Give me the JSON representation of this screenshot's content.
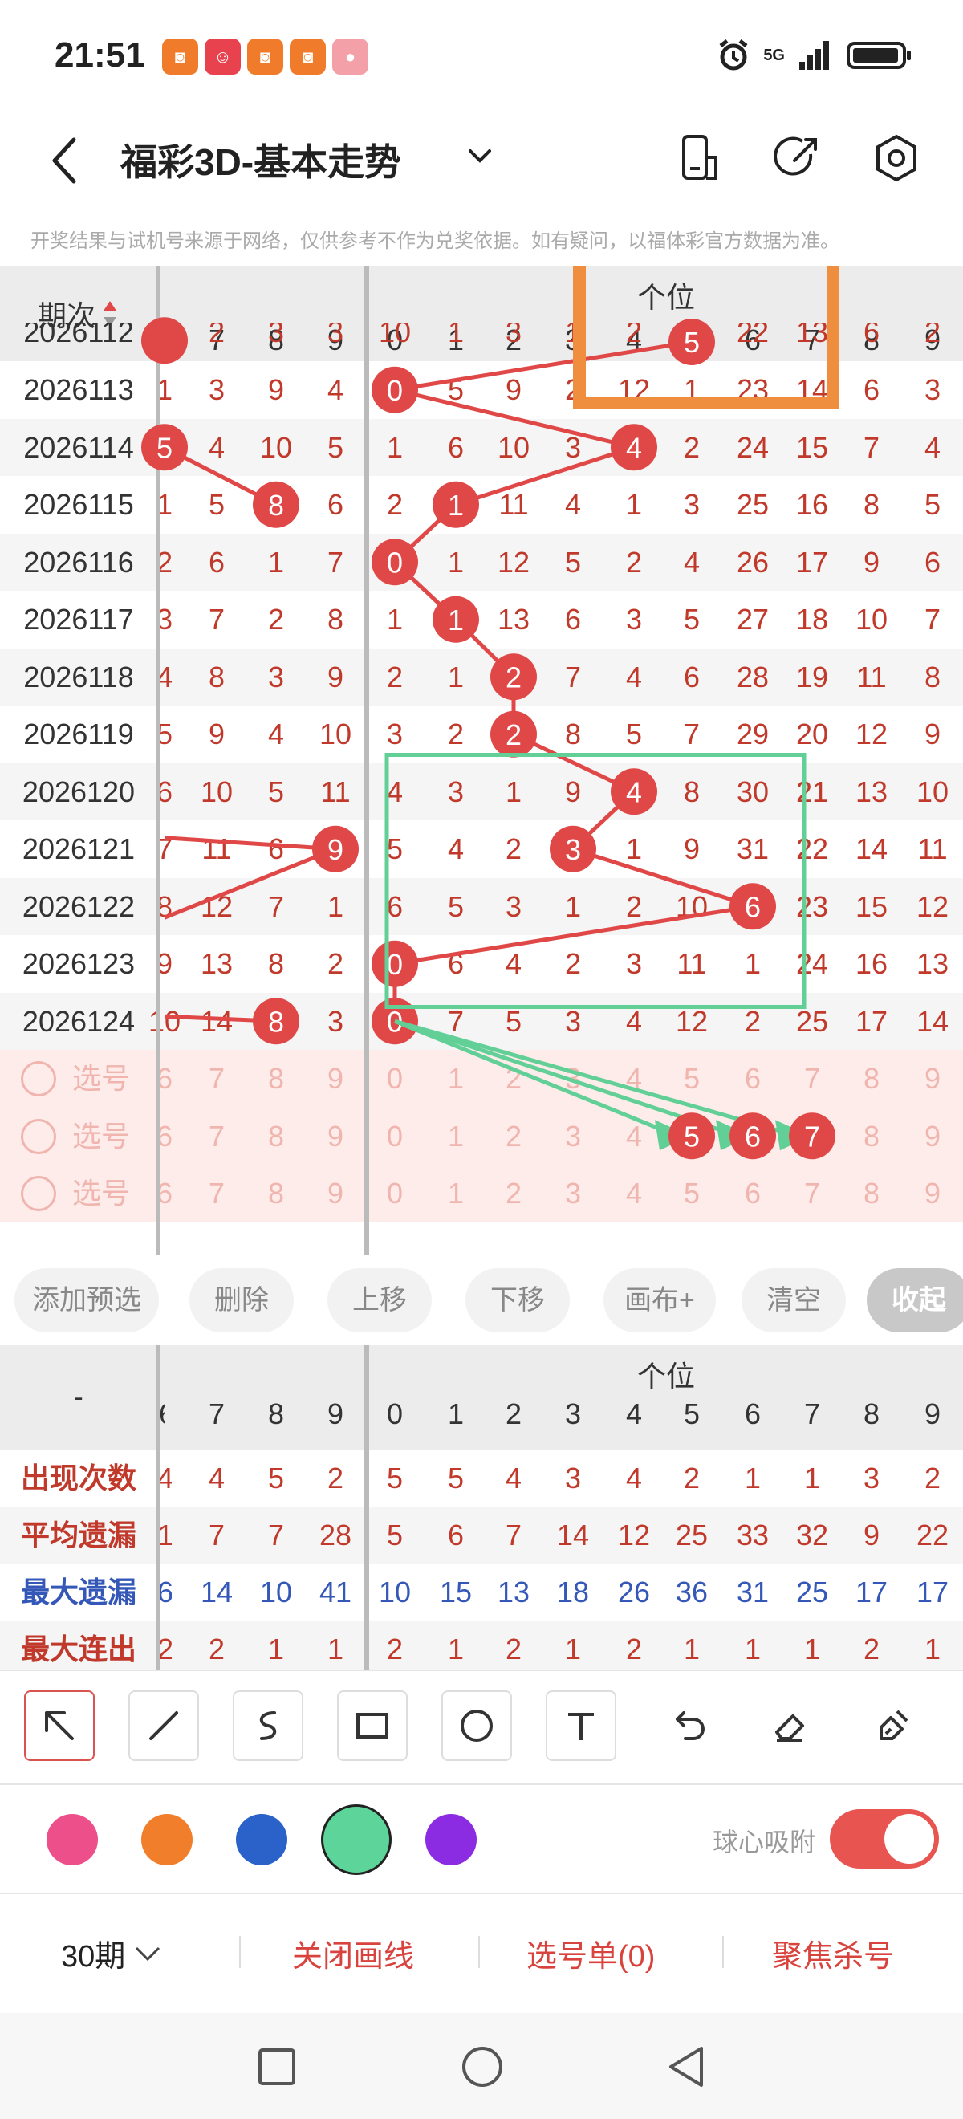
{
  "status": {
    "time": "21:51",
    "network": "5G",
    "app_icons": [
      "app-icon-1",
      "app-icon-2",
      "app-icon-3",
      "app-icon-4",
      "app-icon-5"
    ]
  },
  "header": {
    "title": "福彩3D-基本走势"
  },
  "notice": "开奖结果与试机号来源于网络，仅供参考不作为兑奖依据。如有疑问，以福体彩官方数据为准。",
  "trend": {
    "period_label": "期次",
    "section_label": "个位",
    "cut_left_col_label": "6",
    "left_cols": [
      "7",
      "8",
      "9"
    ],
    "digit_cols": [
      "0",
      "1",
      "2",
      "3",
      "4",
      "5",
      "6",
      "7",
      "8",
      "9"
    ],
    "top_partial_period": "2026112",
    "top_partial_cells": [
      "",
      "2",
      "3",
      "3",
      "10",
      "1",
      "3",
      "1",
      "2",
      "5",
      "22",
      "13",
      "6",
      "2"
    ],
    "rows": [
      {
        "period": "2026113",
        "cells": [
          "1",
          "3",
          "9",
          "4",
          "0",
          "5",
          "9",
          "2",
          "12",
          "1",
          "23",
          "14",
          "6",
          "3"
        ]
      },
      {
        "period": "2026114",
        "cells": [
          "5",
          "4",
          "10",
          "5",
          "1",
          "6",
          "10",
          "3",
          "4",
          "2",
          "24",
          "15",
          "7",
          "4"
        ]
      },
      {
        "period": "2026115",
        "cells": [
          "1",
          "5",
          "8",
          "6",
          "2",
          "1",
          "11",
          "4",
          "1",
          "3",
          "25",
          "16",
          "8",
          "5"
        ]
      },
      {
        "period": "2026116",
        "cells": [
          "2",
          "6",
          "1",
          "7",
          "0",
          "1",
          "12",
          "5",
          "2",
          "4",
          "26",
          "17",
          "9",
          "6"
        ]
      },
      {
        "period": "2026117",
        "cells": [
          "3",
          "7",
          "2",
          "8",
          "1",
          "1",
          "13",
          "6",
          "3",
          "5",
          "27",
          "18",
          "10",
          "7"
        ]
      },
      {
        "period": "2026118",
        "cells": [
          "4",
          "8",
          "3",
          "9",
          "2",
          "1",
          "2",
          "7",
          "4",
          "6",
          "28",
          "19",
          "11",
          "8"
        ]
      },
      {
        "period": "2026119",
        "cells": [
          "5",
          "9",
          "4",
          "10",
          "3",
          "2",
          "2",
          "8",
          "5",
          "7",
          "29",
          "20",
          "12",
          "9"
        ]
      },
      {
        "period": "2026120",
        "cells": [
          "6",
          "10",
          "5",
          "11",
          "4",
          "3",
          "1",
          "9",
          "4",
          "8",
          "30",
          "21",
          "13",
          "10"
        ]
      },
      {
        "period": "2026121",
        "cells": [
          "7",
          "11",
          "6",
          "9",
          "5",
          "4",
          "2",
          "3",
          "1",
          "9",
          "31",
          "22",
          "14",
          "11"
        ]
      },
      {
        "period": "2026122",
        "cells": [
          "8",
          "12",
          "7",
          "1",
          "6",
          "5",
          "3",
          "1",
          "2",
          "10",
          "6",
          "23",
          "15",
          "12"
        ]
      },
      {
        "period": "2026123",
        "cells": [
          "9",
          "13",
          "8",
          "2",
          "0",
          "6",
          "4",
          "2",
          "3",
          "11",
          "1",
          "24",
          "16",
          "13"
        ]
      },
      {
        "period": "2026124",
        "cells": [
          "10",
          "14",
          "8",
          "3",
          "0",
          "7",
          "5",
          "3",
          "4",
          "12",
          "2",
          "25",
          "17",
          "14"
        ]
      }
    ],
    "pick_label": "选号",
    "pick_cells": [
      "6",
      "7",
      "8",
      "9",
      "0",
      "1",
      "2",
      "3",
      "4",
      "5",
      "6",
      "7",
      "8",
      "9"
    ]
  },
  "actions": [
    "添加预选",
    "删除",
    "上移",
    "下移",
    "画布+",
    "清空",
    "收起"
  ],
  "stats": {
    "dash": "-",
    "section_label": "个位",
    "rows": [
      {
        "label": "出现次数",
        "color": "#c0392b",
        "cells": [
          "4",
          "4",
          "5",
          "2",
          "5",
          "5",
          "4",
          "3",
          "4",
          "2",
          "1",
          "1",
          "3",
          "2"
        ]
      },
      {
        "label": "平均遗漏",
        "color": "#c0392b",
        "cells": [
          "1",
          "7",
          "7",
          "28",
          "5",
          "6",
          "7",
          "14",
          "12",
          "25",
          "33",
          "32",
          "9",
          "22"
        ]
      },
      {
        "label": "最大遗漏",
        "color": "#3558b8",
        "cells": [
          "6",
          "14",
          "10",
          "41",
          "10",
          "15",
          "13",
          "18",
          "26",
          "36",
          "31",
          "25",
          "17",
          "17"
        ]
      },
      {
        "label": "最大连出",
        "color": "#c0392b",
        "cells": [
          "2",
          "2",
          "1",
          "1",
          "2",
          "1",
          "2",
          "1",
          "2",
          "1",
          "1",
          "1",
          "2",
          "1"
        ]
      }
    ]
  },
  "tools": [
    "arrow-tool-icon",
    "line-tool-icon",
    "curve-tool-icon",
    "rect-tool-icon",
    "circle-tool-icon",
    "text-tool-icon",
    "undo-icon",
    "eraser-icon",
    "clear-brush-icon"
  ],
  "palette": {
    "colors": [
      "#ec4f8a",
      "#f07e2a",
      "#2a62c9",
      "#5dd59a",
      "#8b2be2"
    ],
    "selected_index": 3,
    "snap_label": "球心吸附",
    "snap_on": true
  },
  "bottom_bar": {
    "periods": "30期",
    "close_lines": "关闭画线",
    "pick_list": "选号单(0)",
    "focus_kill": "聚焦杀号"
  },
  "theme": {
    "accent": "#e85550",
    "ball": "#e04848",
    "green_annotation": "#62cf97",
    "orange_annotation": "#ee8e3e"
  }
}
